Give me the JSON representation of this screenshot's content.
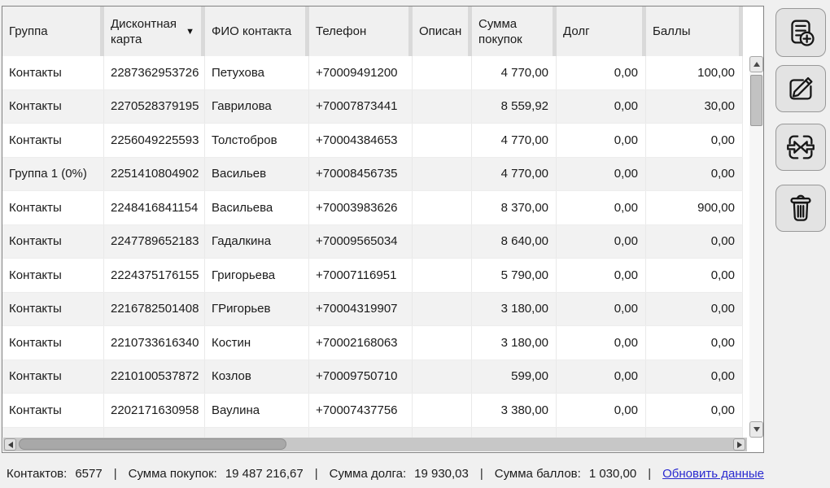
{
  "table": {
    "columns": [
      {
        "label": "Группа"
      },
      {
        "label": "Дисконтная карта",
        "sort_icon": "▼"
      },
      {
        "label": "ФИО контакта"
      },
      {
        "label": "Телефон"
      },
      {
        "label": "Описан"
      },
      {
        "label": "Сумма покупок"
      },
      {
        "label": "Долг"
      },
      {
        "label": "Баллы"
      }
    ],
    "rows": [
      [
        "Контакты",
        "2287362953726",
        "Петухова",
        "+70009491200",
        "",
        "4 770,00",
        "0,00",
        "100,00"
      ],
      [
        "Контакты",
        "2270528379195",
        "Гаврилова",
        "+70007873441",
        "",
        "8 559,92",
        "0,00",
        "30,00"
      ],
      [
        "Контакты",
        "2256049225593",
        "Толстобров",
        "+70004384653",
        "",
        "4 770,00",
        "0,00",
        "0,00"
      ],
      [
        "Группа 1 (0%)",
        "2251410804902",
        "Васильев",
        "+70008456735",
        "",
        "4 770,00",
        "0,00",
        "0,00"
      ],
      [
        "Контакты",
        "2248416841154",
        "Васильева",
        "+70003983626",
        "",
        "8 370,00",
        "0,00",
        "900,00"
      ],
      [
        "Контакты",
        "2247789652183",
        "Гадалкина",
        "+70009565034",
        "",
        "8 640,00",
        "0,00",
        "0,00"
      ],
      [
        "Контакты",
        "2224375176155",
        "Григорьева",
        "+70007116951",
        "",
        "5 790,00",
        "0,00",
        "0,00"
      ],
      [
        "Контакты",
        "2216782501408",
        "ГРигорьев",
        "+70004319907",
        "",
        "3 180,00",
        "0,00",
        "0,00"
      ],
      [
        "Контакты",
        "2210733616340",
        "Костин",
        "+70002168063",
        "",
        "3 180,00",
        "0,00",
        "0,00"
      ],
      [
        "Контакты",
        "2210100537872",
        "Козлов",
        "+70009750710",
        "",
        "599,00",
        "0,00",
        "0,00"
      ],
      [
        "Контакты",
        "2202171630958",
        "Ваулина",
        "+70007437756",
        "",
        "3 380,00",
        "0,00",
        "0,00"
      ]
    ]
  },
  "toolbar": {
    "buttons": [
      {
        "name": "add-contact",
        "icon": "document-plus-icon"
      },
      {
        "name": "edit-contact",
        "icon": "pencil-square-icon"
      },
      {
        "name": "merge-contacts",
        "icon": "merge-arrows-icon"
      },
      {
        "name": "delete-contact",
        "icon": "trash-icon"
      }
    ]
  },
  "statusbar": {
    "separator": "|",
    "contacts_label": "Контактов:",
    "contacts_value": "6577",
    "purchases_label": "Сумма покупок:",
    "purchases_value": "19 487 216,67",
    "debt_label": "Сумма долга:",
    "debt_value": "19 930,03",
    "points_label": "Сумма баллов:",
    "points_value": "1 030,00",
    "refresh_link": "Обновить данные"
  },
  "colors": {
    "link": "#2a2ad0",
    "row_alt": "#f2f2f2",
    "header_bg": "#f0f0f0",
    "panel_border": "#828282"
  }
}
